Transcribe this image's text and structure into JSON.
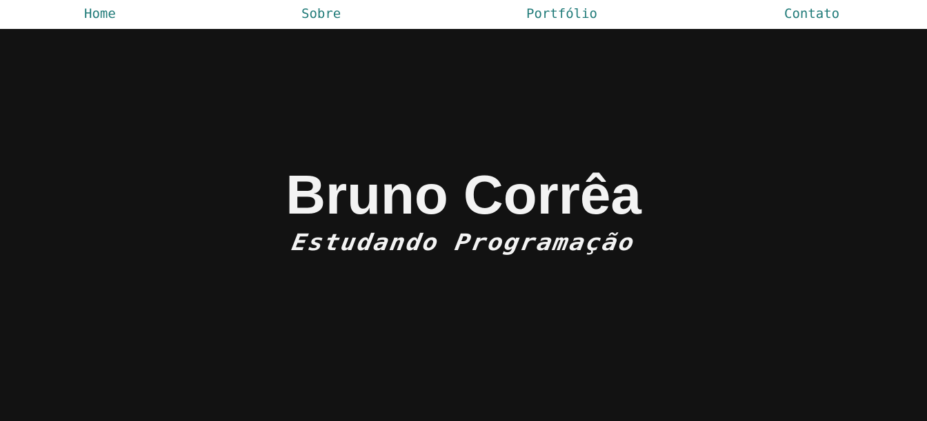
{
  "nav": {
    "items": [
      {
        "label": "Home"
      },
      {
        "label": "Sobre"
      },
      {
        "label": "Portfólio"
      },
      {
        "label": "Contato"
      }
    ]
  },
  "hero": {
    "name": "Bruno Corrêa",
    "subtitle": "Estudando Programação"
  },
  "colors": {
    "nav_background": "#ffffff",
    "nav_link": "#1f7a78",
    "hero_background": "#121212",
    "hero_text": "#f3f3f3"
  }
}
